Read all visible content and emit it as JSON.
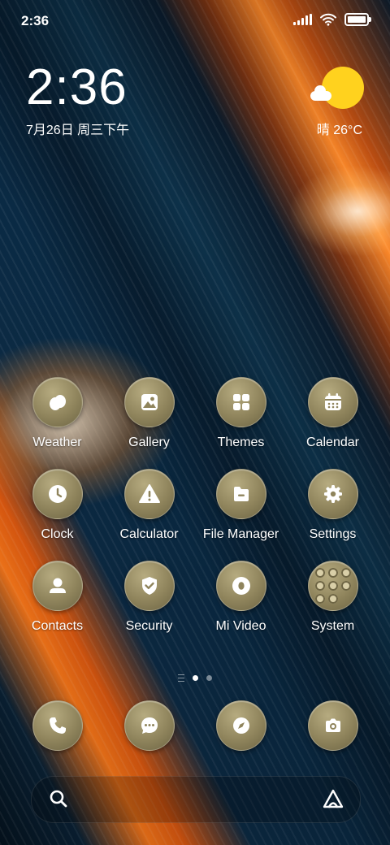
{
  "status_bar": {
    "time": "2:36"
  },
  "clock_widget": {
    "time": "2:36",
    "date": "7月26日 周三下午"
  },
  "weather_widget": {
    "text": "晴 26°C"
  },
  "apps": [
    {
      "label": "Weather",
      "icon": "weather-icon"
    },
    {
      "label": "Gallery",
      "icon": "gallery-icon"
    },
    {
      "label": "Themes",
      "icon": "themes-icon"
    },
    {
      "label": "Calendar",
      "icon": "calendar-icon"
    },
    {
      "label": "Clock",
      "icon": "clock-icon"
    },
    {
      "label": "Calculator",
      "icon": "warning-icon"
    },
    {
      "label": "File Manager",
      "icon": "file-manager-icon"
    },
    {
      "label": "Settings",
      "icon": "settings-icon"
    },
    {
      "label": "Contacts",
      "icon": "contacts-icon"
    },
    {
      "label": "Security",
      "icon": "security-icon"
    },
    {
      "label": "Mi Video",
      "icon": "mi-video-icon"
    },
    {
      "label": "System",
      "icon": "system-folder-icon"
    }
  ],
  "page_indicator": {
    "active_index": 0,
    "total": 2
  },
  "dock": [
    {
      "icon": "phone-icon"
    },
    {
      "icon": "messages-icon"
    },
    {
      "icon": "browser-icon"
    },
    {
      "icon": "camera-icon"
    }
  ],
  "search_bar": {
    "left_icon": "search-icon",
    "right_icon": "assistant-icon"
  },
  "colors": {
    "icon_bg": "#8f845c",
    "accent_sun": "#ffd21e"
  }
}
